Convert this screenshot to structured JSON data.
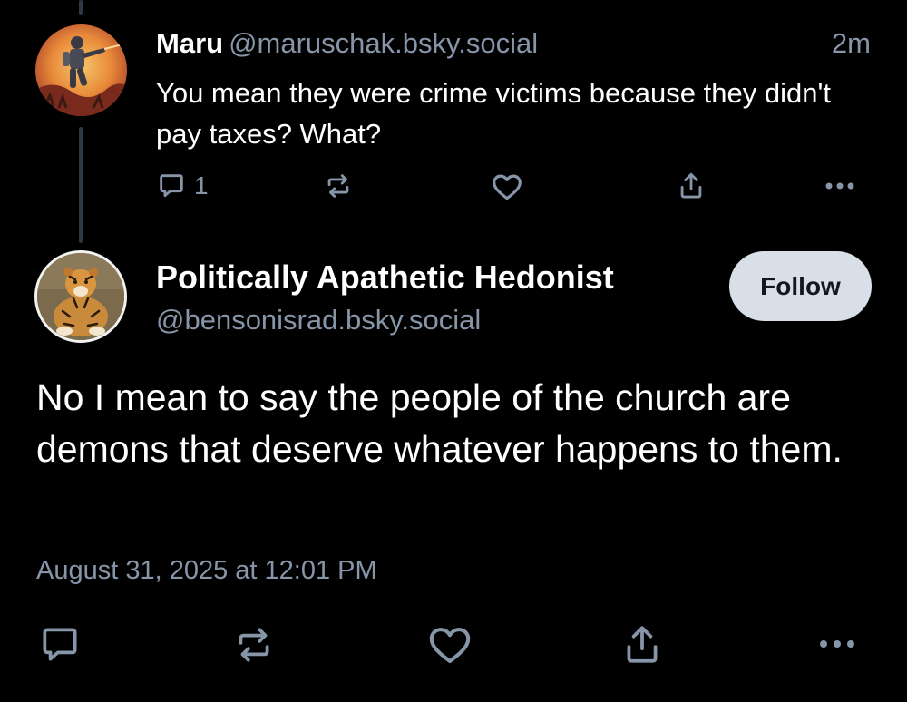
{
  "colors": {
    "background": "#000000",
    "text_primary": "#ffffff",
    "text_secondary": "#8795a8",
    "thread_line": "#2e3843",
    "follow_button_bg": "#d8dfe8",
    "follow_button_text": "#111820"
  },
  "reply": {
    "author_name": "Maru",
    "author_handle": "@maruschak.bsky.social",
    "time_ago": "2m",
    "text": "You mean they were crime victims because they didn't pay taxes? What?",
    "avatar_icon": "astronaut-avatar",
    "actions": {
      "reply_icon": "comment-icon",
      "reply_count": "1",
      "repost_icon": "repost-icon",
      "like_icon": "heart-icon",
      "share_icon": "share-icon",
      "more_icon": "more-icon"
    }
  },
  "post": {
    "author_name": "Politically Apathetic Hedonist",
    "author_handle": "@bensonisrad.bsky.social",
    "avatar_icon": "tiger-avatar",
    "follow_label": "Follow",
    "text": "No I mean to say the people of the church are demons that deserve whatever happens to them.",
    "timestamp": "August 31, 2025 at 12:01 PM",
    "actions": {
      "reply_icon": "comment-icon",
      "repost_icon": "repost-icon",
      "like_icon": "heart-icon",
      "share_icon": "share-icon",
      "more_icon": "more-icon"
    }
  }
}
